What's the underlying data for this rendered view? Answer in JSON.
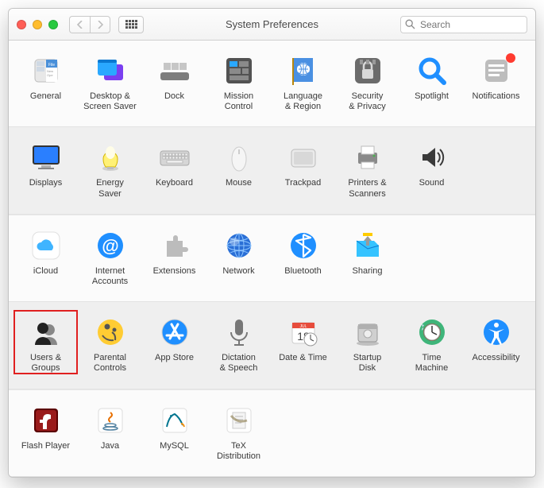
{
  "window": {
    "title": "System Preferences"
  },
  "search": {
    "placeholder": "Search"
  },
  "rows": [
    [
      {
        "key": "general",
        "label": "General"
      },
      {
        "key": "desktop",
        "label": "Desktop &\nScreen Saver"
      },
      {
        "key": "dock",
        "label": "Dock"
      },
      {
        "key": "mission",
        "label": "Mission\nControl"
      },
      {
        "key": "language",
        "label": "Language\n& Region"
      },
      {
        "key": "security",
        "label": "Security\n& Privacy"
      },
      {
        "key": "spotlight",
        "label": "Spotlight"
      },
      {
        "key": "notifications",
        "label": "Notifications",
        "badge": true
      }
    ],
    [
      {
        "key": "displays",
        "label": "Displays"
      },
      {
        "key": "energy",
        "label": "Energy\nSaver"
      },
      {
        "key": "keyboard",
        "label": "Keyboard"
      },
      {
        "key": "mouse",
        "label": "Mouse"
      },
      {
        "key": "trackpad",
        "label": "Trackpad"
      },
      {
        "key": "printers",
        "label": "Printers &\nScanners"
      },
      {
        "key": "sound",
        "label": "Sound"
      }
    ],
    [
      {
        "key": "icloud",
        "label": "iCloud"
      },
      {
        "key": "internet",
        "label": "Internet\nAccounts"
      },
      {
        "key": "extensions",
        "label": "Extensions"
      },
      {
        "key": "network",
        "label": "Network"
      },
      {
        "key": "bluetooth",
        "label": "Bluetooth"
      },
      {
        "key": "sharing",
        "label": "Sharing"
      }
    ],
    [
      {
        "key": "users",
        "label": "Users &\nGroups",
        "highlighted": true
      },
      {
        "key": "parental",
        "label": "Parental\nControls"
      },
      {
        "key": "appstore",
        "label": "App Store"
      },
      {
        "key": "dictation",
        "label": "Dictation\n& Speech"
      },
      {
        "key": "datetime",
        "label": "Date & Time"
      },
      {
        "key": "startup",
        "label": "Startup\nDisk"
      },
      {
        "key": "timemachine",
        "label": "Time\nMachine"
      },
      {
        "key": "accessibility",
        "label": "Accessibility"
      }
    ],
    [
      {
        "key": "flash",
        "label": "Flash Player"
      },
      {
        "key": "java",
        "label": "Java"
      },
      {
        "key": "mysql",
        "label": "MySQL"
      },
      {
        "key": "tex",
        "label": "TeX\nDistribution"
      }
    ]
  ]
}
